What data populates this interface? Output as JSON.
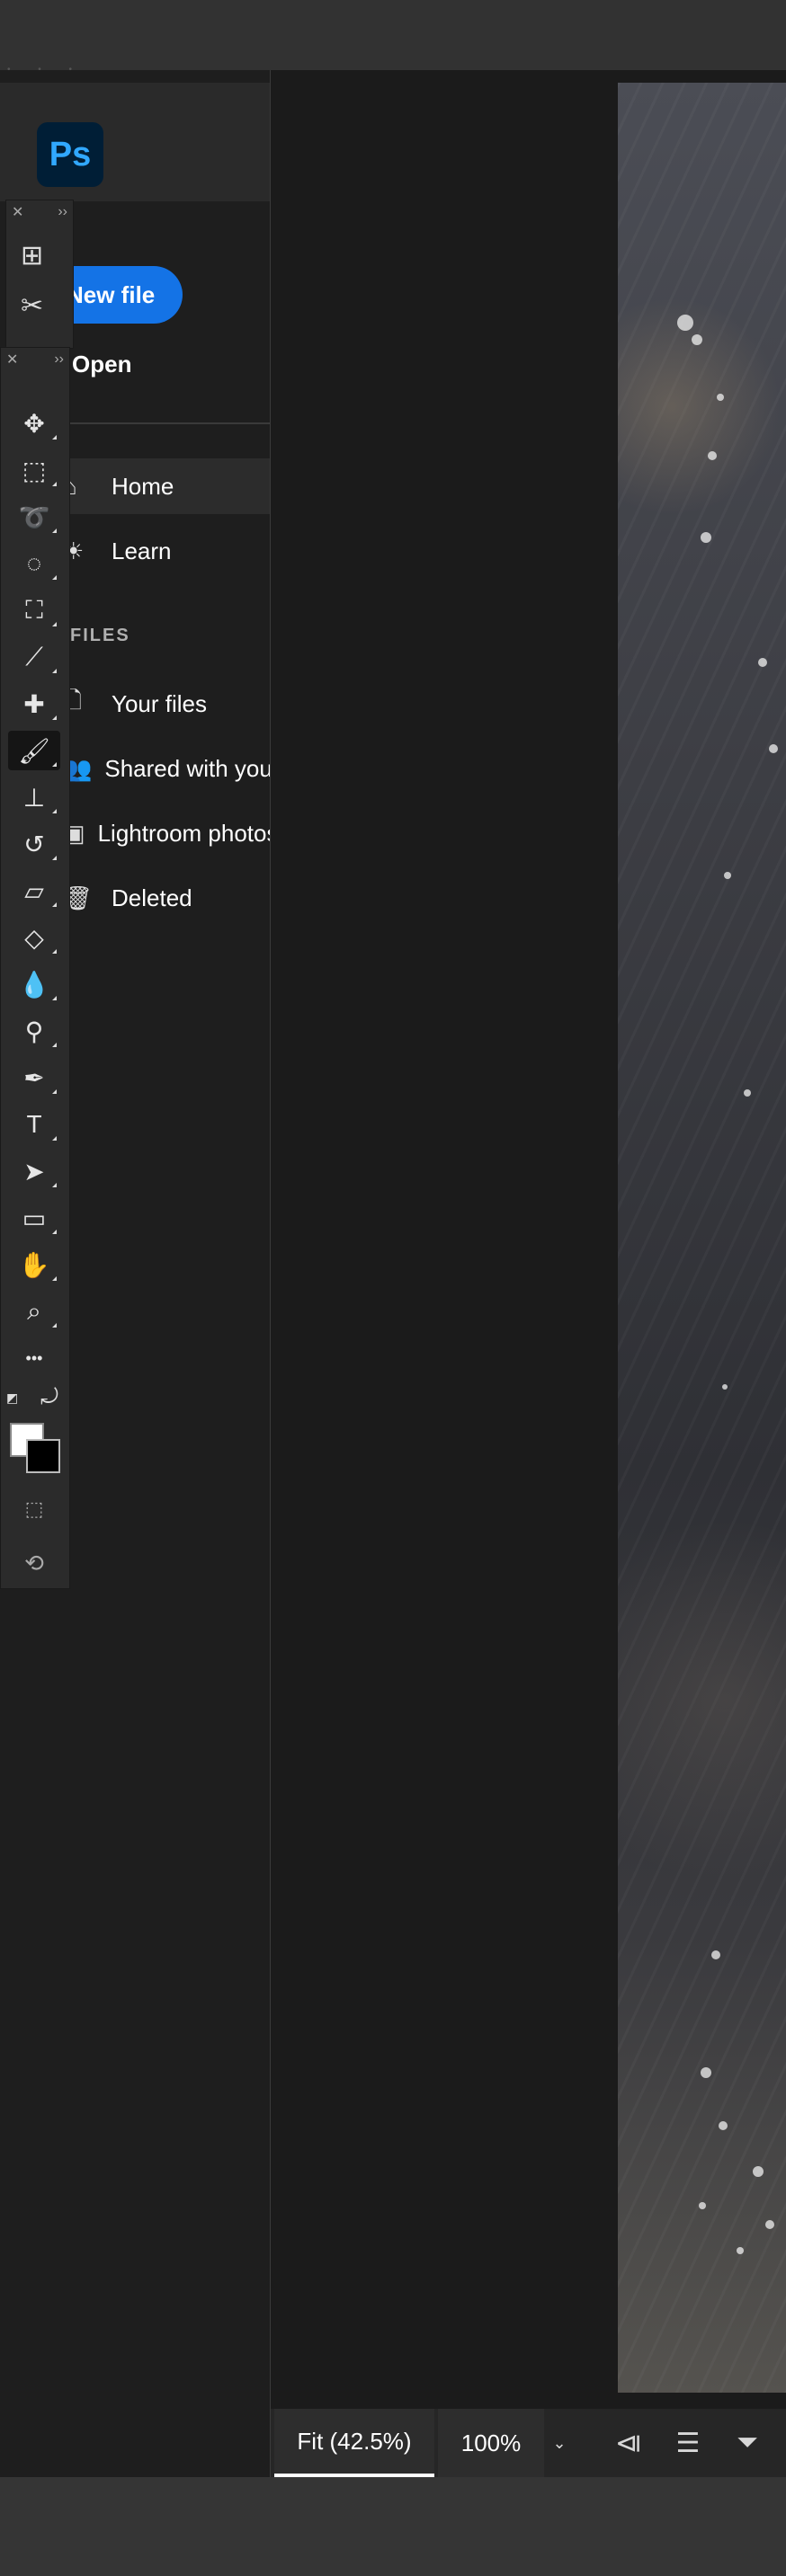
{
  "home": {
    "logo": "Ps",
    "new_file": "New file",
    "open": "Open",
    "nav": [
      {
        "label": "Home",
        "icon": "home-icon",
        "active": true
      },
      {
        "label": "Learn",
        "icon": "lightbulb-icon",
        "active": false
      }
    ],
    "section_files": "FILES",
    "files": [
      {
        "label": "Your files",
        "icon": "document-icon"
      },
      {
        "label": "Shared with you",
        "icon": "people-icon"
      },
      {
        "label": "Lightroom photos",
        "icon": "lightroom-icon"
      },
      {
        "label": "Deleted",
        "icon": "trash-icon"
      }
    ]
  },
  "tools": [
    {
      "name": "move-tool",
      "glyph": "✥"
    },
    {
      "name": "rectangular-marquee-tool",
      "glyph": "⬚"
    },
    {
      "name": "lasso-tool",
      "glyph": "➰"
    },
    {
      "name": "quick-selection-tool",
      "glyph": "◌"
    },
    {
      "name": "crop-tool",
      "glyph": "⛶"
    },
    {
      "name": "eyedropper-tool",
      "glyph": "⟋"
    },
    {
      "name": "spot-healing-tool",
      "glyph": "✚"
    },
    {
      "name": "brush-tool",
      "glyph": "🖌"
    },
    {
      "name": "clone-stamp-tool",
      "glyph": "⊥"
    },
    {
      "name": "history-brush-tool",
      "glyph": "↺"
    },
    {
      "name": "eraser-tool",
      "glyph": "▱"
    },
    {
      "name": "paint-bucket-tool",
      "glyph": "◇"
    },
    {
      "name": "blur-tool",
      "glyph": "💧"
    },
    {
      "name": "dodge-tool",
      "glyph": "⚲"
    },
    {
      "name": "pen-tool",
      "glyph": "✒"
    },
    {
      "name": "type-tool",
      "glyph": "T"
    },
    {
      "name": "path-selection-tool",
      "glyph": "➤"
    },
    {
      "name": "rectangle-tool",
      "glyph": "▭"
    },
    {
      "name": "hand-tool",
      "glyph": "✋"
    },
    {
      "name": "zoom-tool",
      "glyph": "⌕"
    },
    {
      "name": "edit-toolbar",
      "glyph": "•••"
    }
  ],
  "colors": {
    "foreground": "#ffffff",
    "background": "#000000",
    "accent": "#1473e6"
  },
  "bottombar": {
    "fit": "Fit (42.5%)",
    "zoom": "100%",
    "dropdown": "⌄",
    "icons": [
      "navigator-icon",
      "align-icon",
      "filter-icon"
    ]
  }
}
